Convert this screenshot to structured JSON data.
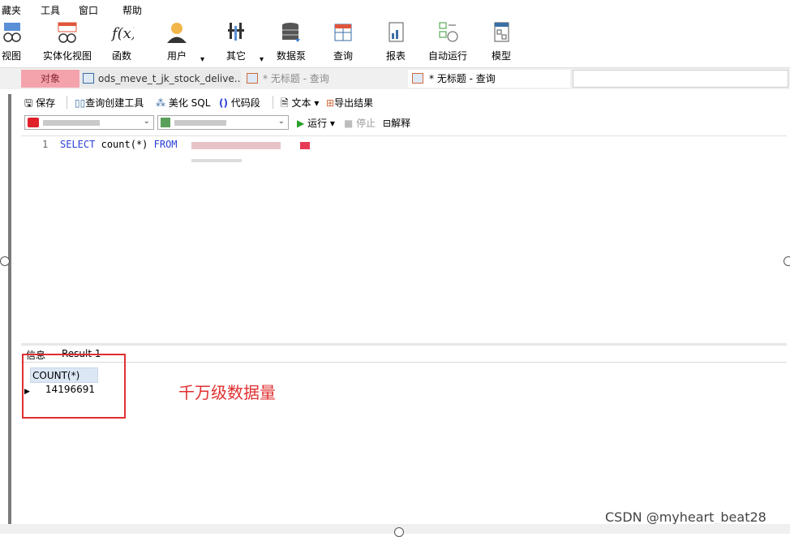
{
  "menu": [
    "藏夹",
    "工具",
    "窗口",
    "帮助"
  ],
  "toolbar": {
    "items": [
      "视图",
      "实体化视图",
      "函数",
      "用户",
      "其它",
      "数据泵",
      "查询",
      "报表",
      "自动运行",
      "模型"
    ]
  },
  "tabs": {
    "objects": "对象",
    "table_tab": "ods_meve_t_jk_stock_delive...",
    "query_tab1": "* 无标题 - 查询",
    "query_tab2": "* 无标题 - 查询"
  },
  "query_toolbar": {
    "save": "保存",
    "query_builder": "查询创建工具",
    "beautify": "美化 SQL",
    "snippet": "代码段",
    "text": "文本",
    "export": "导出结果",
    "run": "运行",
    "stop": "停止",
    "explain": "解释"
  },
  "editor": {
    "line_number": "1",
    "kw_select": "SELECT",
    "fn": "count(*)",
    "kw_from": "FROM"
  },
  "results": {
    "tabs": [
      "信息",
      "Result 1"
    ],
    "column": "COUNT(*)",
    "value": "14196691"
  },
  "annotation": "千万级数据量",
  "watermark": "CSDN @myheart_beat28",
  "colors": {
    "annotation": "#e03030",
    "keyword": "#2a3fd6",
    "objects_tab": "#f4a3ad"
  }
}
